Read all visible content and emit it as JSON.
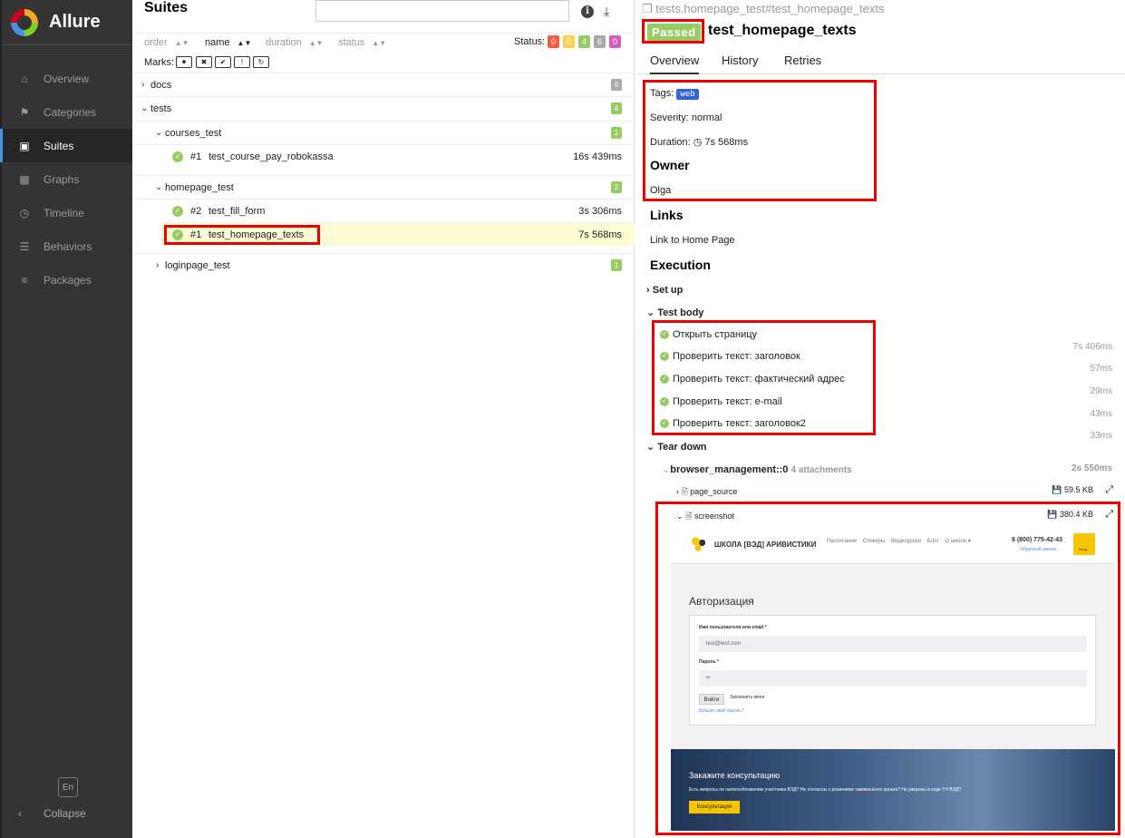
{
  "sidebar": {
    "brand": "Allure",
    "items": [
      {
        "label": "Overview",
        "icon": "home-icon"
      },
      {
        "label": "Categories",
        "icon": "flag-icon"
      },
      {
        "label": "Suites",
        "icon": "briefcase-icon"
      },
      {
        "label": "Graphs",
        "icon": "bar-chart-icon"
      },
      {
        "label": "Timeline",
        "icon": "clock-icon"
      },
      {
        "label": "Behaviors",
        "icon": "list-icon"
      },
      {
        "label": "Packages",
        "icon": "align-left-icon"
      }
    ],
    "active": "Suites",
    "lang": "En",
    "collapse": "Collapse"
  },
  "suites": {
    "title": "Suites",
    "sort": {
      "order": "order",
      "name": "name",
      "duration": "duration",
      "status": "status"
    },
    "status_label": "Status:",
    "status_counts": [
      {
        "value": "0",
        "color": "#fd5a3e"
      },
      {
        "value": "0",
        "color": "#ffd050"
      },
      {
        "value": "4",
        "color": "#97cc64"
      },
      {
        "value": "6",
        "color": "#aaaaaa"
      },
      {
        "value": "0",
        "color": "#d35ebe"
      }
    ],
    "marks_label": "Marks:",
    "tree": {
      "docs": {
        "label": "docs",
        "count": "6"
      },
      "tests": {
        "label": "tests",
        "count": "4"
      },
      "courses_test": {
        "label": "courses_test",
        "count": "1"
      },
      "course_item": {
        "num": "#1",
        "name": "test_course_pay_robokassa",
        "duration": "16s 439ms"
      },
      "homepage_test": {
        "label": "homepage_test",
        "count": "2"
      },
      "fill_item": {
        "num": "#2",
        "name": "test_fill_form",
        "duration": "3s 306ms"
      },
      "texts_item": {
        "num": "#1",
        "name": "test_homepage_texts",
        "duration": "7s 568ms"
      },
      "loginpage_test": {
        "label": "loginpage_test",
        "count": "1"
      }
    }
  },
  "test": {
    "breadcrumb": "tests.homepage_test#test_homepage_texts",
    "status": "Passed",
    "title": "test_homepage_texts",
    "tabs": [
      "Overview",
      "History",
      "Retries"
    ],
    "tags_label": "Tags:",
    "tag": "web",
    "severity": "Severity: normal",
    "duration_label": "Duration:",
    "duration": "7s 568ms",
    "owner_heading": "Owner",
    "owner": "Olga",
    "links_heading": "Links",
    "link": "Link to Home Page",
    "execution_heading": "Execution",
    "setup": "Set up",
    "test_body": "Test body",
    "steps": [
      {
        "name": "Открыть страницу",
        "duration": "7s 406ms"
      },
      {
        "name": "Проверить текст: заголовок",
        "duration": "57ms"
      },
      {
        "name": "Проверить текст: фактический адрес",
        "duration": "29ms"
      },
      {
        "name": "Проверить текст: e-mail",
        "duration": "43ms"
      },
      {
        "name": "Проверить текст: заголовок2",
        "duration": "33ms"
      }
    ],
    "teardown": "Tear down",
    "fixture": {
      "name": "browser_management::0",
      "attachments": "4 attachments",
      "duration": "2s 550ms"
    },
    "attachments": [
      {
        "name": "page_source",
        "size": "59.5 KB"
      },
      {
        "name": "screenshot",
        "size": "380.4 KB"
      }
    ]
  },
  "screenshot": {
    "site_name": "ШКОЛА [ВЭД] АРИВИСТИКИ",
    "nav": "Расписание    Спикеры    Видеоуроки    Блог    О школе ▾",
    "phone": "8 (800) 775-42-43",
    "callback": "Обратный звонок",
    "login_btn": "Вход",
    "heading": "Авторизация",
    "user_label": "Имя пользователя или email *",
    "user_value": "test@test.com",
    "pass_label": "Пароль *",
    "pass_value": "••",
    "submit": "Войти",
    "remember": "Запомнить меня",
    "forgot": "Забыли свой пароль?",
    "banner_title": "Закажите консультацию",
    "banner_text": "Есть вопросы по налогообложению участника ВЭД? Не согласны с решением таможенного органа? Не уверены в коде ТН ВЭД?",
    "banner_btn": "Консультация"
  }
}
